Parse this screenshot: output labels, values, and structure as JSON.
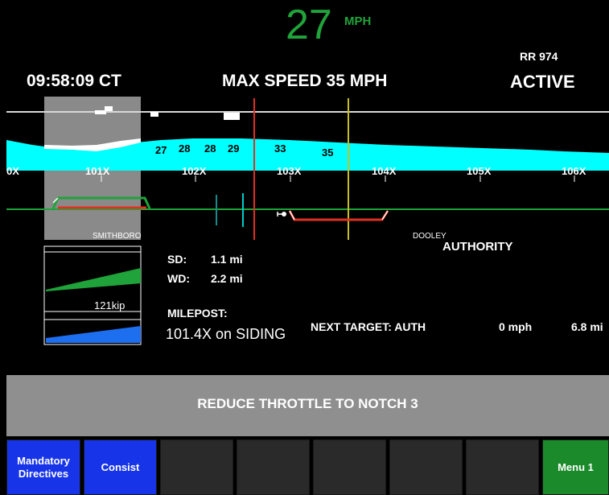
{
  "header": {
    "speed_value": "27",
    "speed_unit": "MPH",
    "rr_label": "RR  974",
    "time": "09:58:09 CT",
    "max_speed": "MAX SPEED 35 MPH",
    "status": "ACTIVE"
  },
  "track": {
    "mileposts": [
      "0X",
      "101X",
      "102X",
      "103X",
      "104X",
      "105X",
      "106X"
    ],
    "speed_limits": [
      "27",
      "28",
      "28",
      "29",
      "33",
      "35"
    ],
    "stations": [
      "SMITHBORO",
      "DOOLEY"
    ],
    "authority_label": "AUTHORITY"
  },
  "info": {
    "sd_label": "SD:",
    "sd_value": "1.1 mi",
    "wd_label": "WD:",
    "wd_value": "2.2 mi",
    "weight": "121kip",
    "milepost_label": "MILEPOST:",
    "milepost_value": "101.4X on SIDING",
    "next_target_label": "NEXT TARGET: AUTH",
    "next_target_speed": "0 mph",
    "next_target_distance": "6.8 mi"
  },
  "message": "REDUCE THROTTLE TO NOTCH 3",
  "softkeys": {
    "mandatory": "Mandatory Directives",
    "consist": "Consist",
    "menu": "Menu 1"
  },
  "colors": {
    "speed": "#1fa33a",
    "profile": "#00ffff",
    "track": "#1fa33a",
    "authority": "#e03020",
    "target_marker": "#c8c020",
    "button_blue": "#1734e8",
    "button_green": "#1a8a2a",
    "message_bar": "#8f8f8f"
  }
}
